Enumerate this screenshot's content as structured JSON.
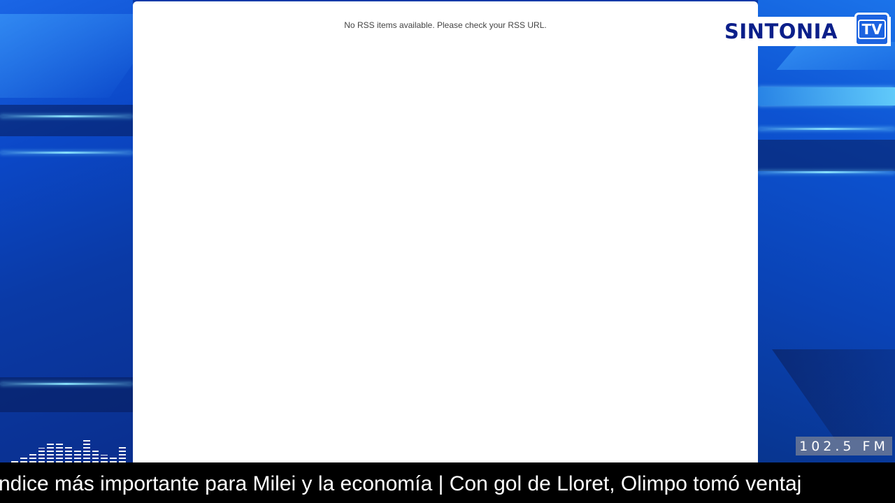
{
  "panel": {
    "message": "No RSS items available. Please check your RSS URL."
  },
  "logo": {
    "name": "SINTONIA",
    "tv": "TV"
  },
  "radio": {
    "frequency": "102.5 FM"
  },
  "ticker": {
    "text": "ndice más importante para Milei y la economía | Con gol de Lloret, Olimpo tomó ventaj"
  },
  "equalizer": {
    "levels": [
      0.1,
      0.2,
      0.35,
      0.5,
      0.65,
      0.65,
      0.6,
      0.45,
      0.8,
      0.4,
      0.25,
      0.2,
      0.55
    ]
  },
  "colors": {
    "brand_blue": "#0b1f8a",
    "tv_blue": "#1c63e0",
    "background_blue": "#0b47c4",
    "ticker_background": "#000000"
  }
}
